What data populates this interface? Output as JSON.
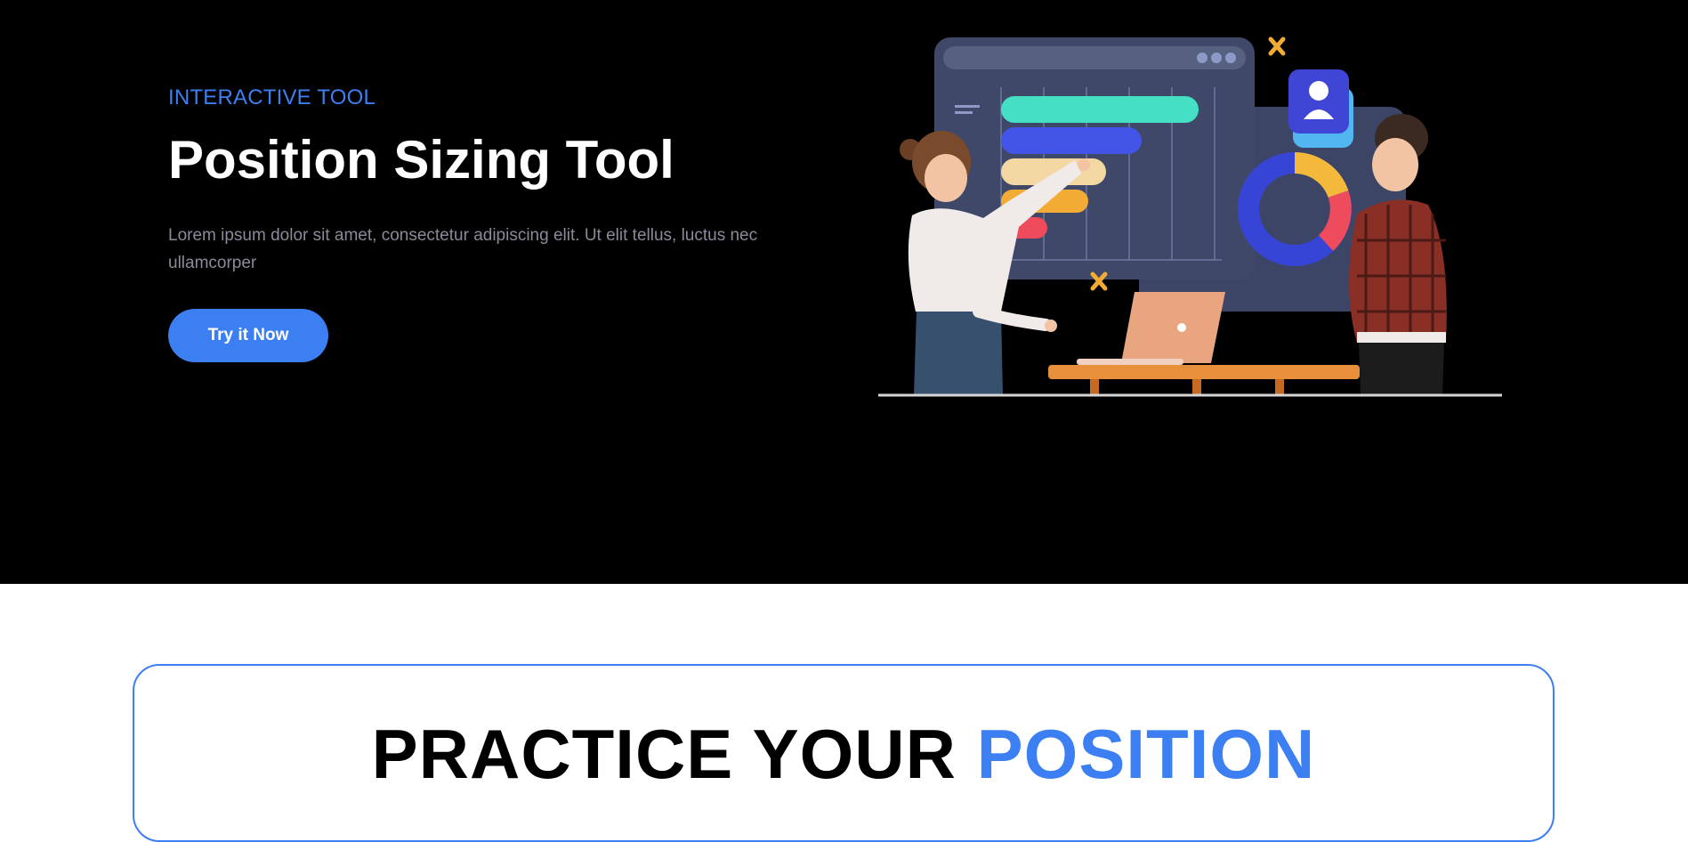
{
  "hero": {
    "eyebrow": "INTERACTIVE TOOL",
    "title": "Position Sizing Tool",
    "description": "Lorem ipsum dolor sit amet, consectetur adipiscing elit. Ut elit tellus, luctus nec ullamcorper",
    "cta_label": "Try it Now",
    "illustration_icon": "analytics-presentation-illustration"
  },
  "practice": {
    "title_part1": "PRACTICE YOUR",
    "title_part2": "POSITION"
  },
  "colors": {
    "accent": "#3b7ff2",
    "hero_background": "#000000",
    "page_background": "#ffffff",
    "muted_text": "#8a8a9a"
  }
}
